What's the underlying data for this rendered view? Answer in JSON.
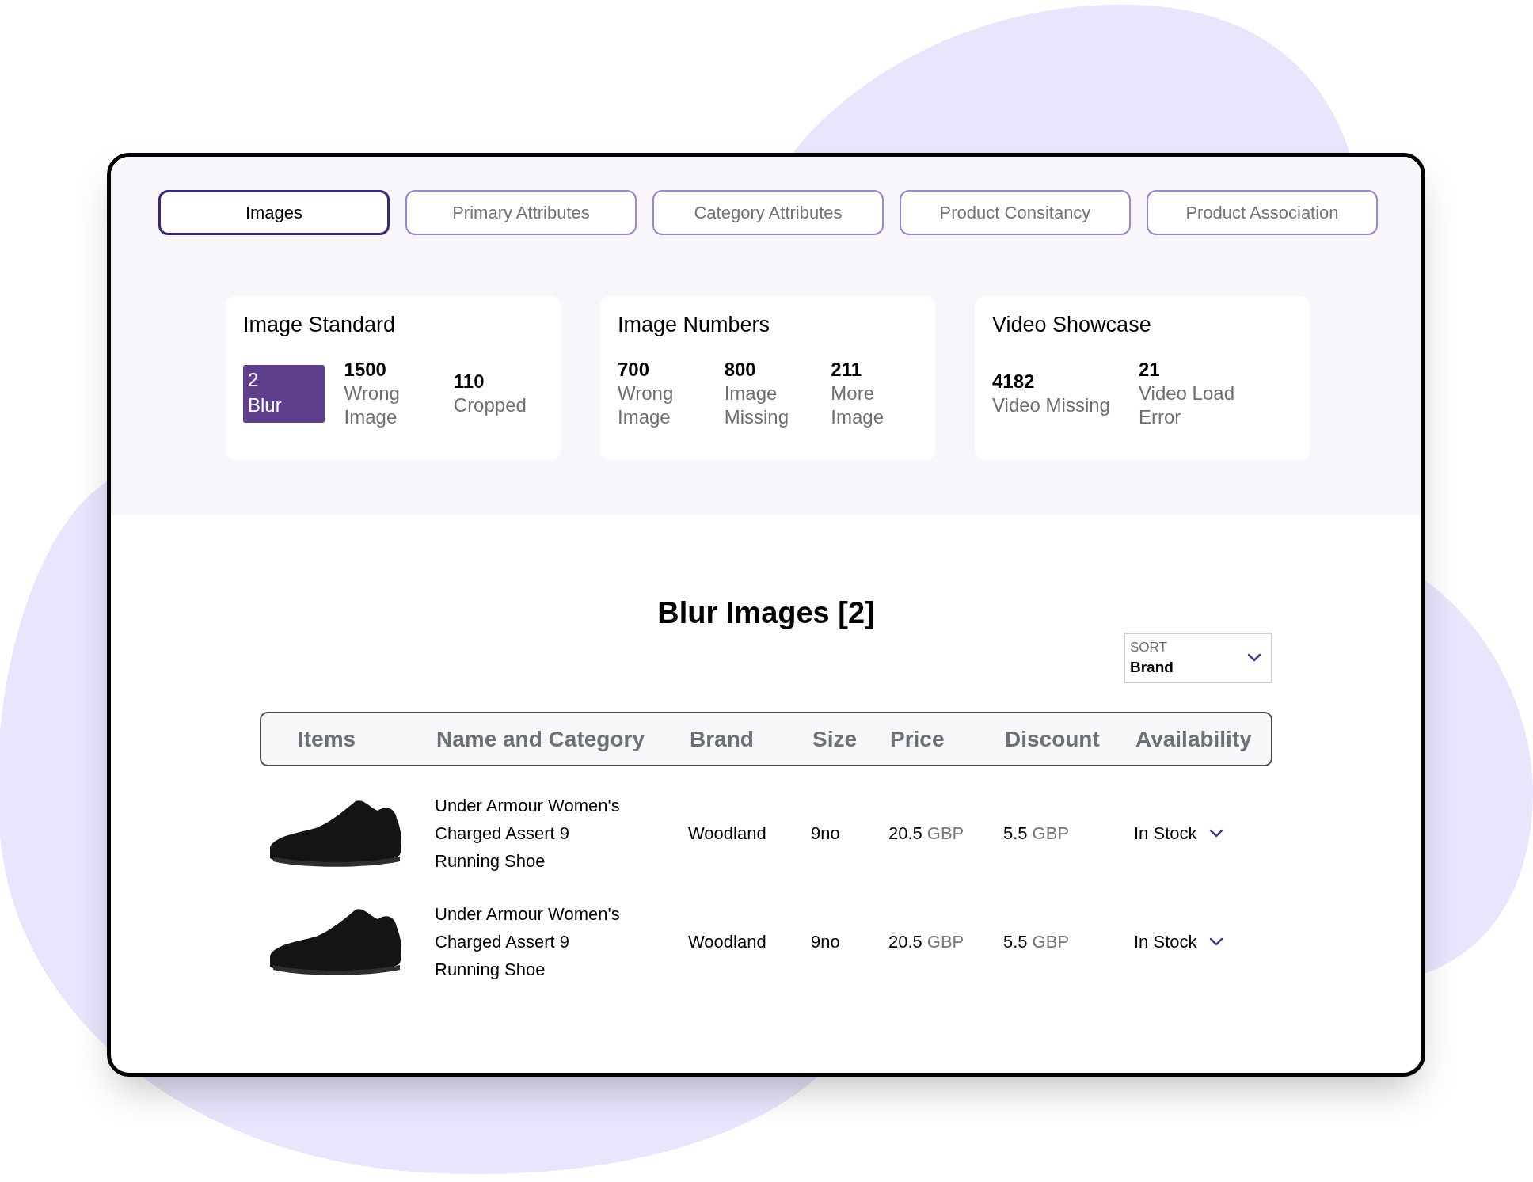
{
  "tabs": [
    {
      "label": "Images",
      "selected": true
    },
    {
      "label": "Primary Attributes",
      "selected": false
    },
    {
      "label": "Category Attributes",
      "selected": false
    },
    {
      "label": "Product Consitancy",
      "selected": false
    },
    {
      "label": "Product Association",
      "selected": false
    }
  ],
  "cards": [
    {
      "title": "Image Standard",
      "metrics": [
        {
          "value": "2",
          "label": "Blur",
          "selected": true
        },
        {
          "value": "1500",
          "label": "Wrong Image",
          "selected": false
        },
        {
          "value": "110",
          "label": "Cropped",
          "selected": false
        }
      ]
    },
    {
      "title": "Image Numbers",
      "metrics": [
        {
          "value": "700",
          "label": "Wrong Image",
          "selected": false
        },
        {
          "value": "800",
          "label": "Image Missing",
          "selected": false
        },
        {
          "value": "211",
          "label": "More Image",
          "selected": false
        }
      ]
    },
    {
      "title": "Video Showcase",
      "metrics": [
        {
          "value": "4182",
          "label": "Video Missing",
          "selected": false
        },
        {
          "value": "21",
          "label": "Video Load Error",
          "selected": false
        }
      ]
    }
  ],
  "section_title": "Blur Images [2]",
  "sort": {
    "label": "SORT",
    "value": "Brand"
  },
  "table": {
    "columns": [
      "Items",
      "Name and Category",
      "Brand",
      "Size",
      "Price",
      "Discount",
      "Availability"
    ],
    "rows": [
      {
        "name": "Under Armour Women's Charged Assert 9 Running Shoe",
        "brand": "Woodland",
        "size": "9no",
        "price": {
          "amount": "20.5",
          "currency": "GBP"
        },
        "discount": {
          "amount": "5.5",
          "currency": "GBP"
        },
        "availability": "In Stock"
      },
      {
        "name": "Under Armour Women's Charged Assert 9 Running Shoe",
        "brand": "Woodland",
        "size": "9no",
        "price": {
          "amount": "20.5",
          "currency": "GBP"
        },
        "discount": {
          "amount": "5.5",
          "currency": "GBP"
        },
        "availability": "In Stock"
      }
    ]
  }
}
